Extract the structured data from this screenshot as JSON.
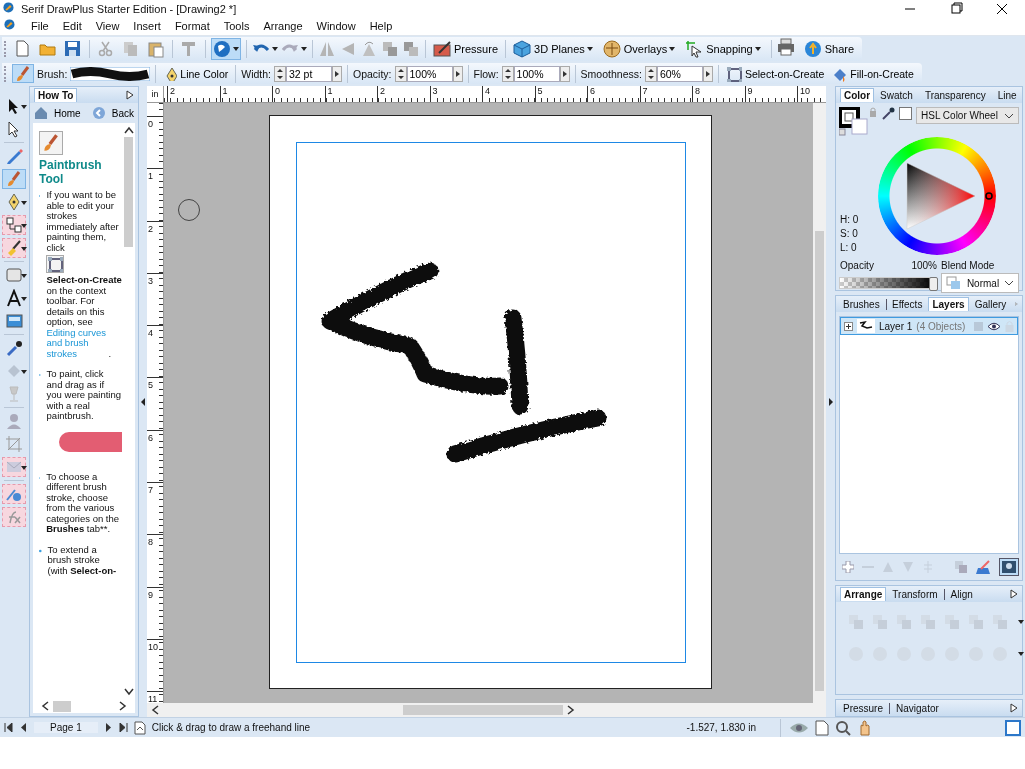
{
  "window": {
    "title": "Serif DrawPlus Starter Edition - [Drawing2 *]"
  },
  "menu": [
    "File",
    "Edit",
    "View",
    "Insert",
    "Format",
    "Tools",
    "Arrange",
    "Window",
    "Help"
  ],
  "quick_tools": [
    {
      "selected": false
    },
    {
      "selected": false
    },
    {
      "selected": false
    },
    {
      "selected": false
    },
    {
      "selected": false
    },
    {
      "selected": false
    },
    {
      "selected": false
    },
    {
      "selected": true
    }
  ],
  "toolbar_buttons": [
    {
      "label": "Pressure",
      "dropdown": false
    },
    {
      "label": "3D Planes",
      "dropdown": true
    },
    {
      "label": "Overlays",
      "dropdown": true
    },
    {
      "label": "Snapping",
      "dropdown": true
    },
    {
      "label": "Share",
      "dropdown": false
    }
  ],
  "context_bar": {
    "brush_label": "Brush:",
    "line_color": "Line Color",
    "fields": [
      {
        "label": "Width:",
        "value": "32 pt"
      },
      {
        "label": "Opacity:",
        "value": "100%"
      },
      {
        "label": "Flow:",
        "value": "100%"
      },
      {
        "label": "Smoothness:",
        "value": "60%"
      }
    ],
    "toggles": [
      {
        "label": "Select-on-Create"
      },
      {
        "label": "Fill-on-Create"
      }
    ]
  },
  "tools": [
    {
      "selected": false
    },
    {
      "selected": false
    },
    {
      "selected": false
    },
    {
      "selected": true
    },
    {
      "selected": false
    },
    {
      "selected": false
    },
    {
      "selected": false
    },
    {
      "selected": false
    },
    {
      "selected": false
    },
    {
      "selected": false
    },
    {
      "selected": false
    },
    {
      "selected": false
    },
    {
      "selected": false
    },
    {
      "selected": false
    },
    {
      "selected": false
    },
    {
      "selected": false
    },
    {
      "selected": false
    },
    {
      "selected": false
    }
  ],
  "howto": {
    "tab": "How To",
    "home": "Home",
    "back": "Back",
    "heading": "Paintbrush Tool",
    "bullets": [
      {
        "text": "If you want to be able to edit your strokes immediately after painting them, click",
        "after_icon": "**Select-on-Create** on the context toolbar. For details on this option, see",
        "link": "Editing curves and brush strokes",
        "end": "."
      },
      {
        "text": "To paint, click and drag as if you were painting with a real paintbrush."
      },
      {
        "text": "To choose a different brush stroke, choose from the various categories on the **Brushes** tab**."
      },
      {
        "text": "To extend a brush stroke (with **Select-on-**"
      }
    ]
  },
  "ruler": {
    "unit": "in",
    "x_labels": [
      "2",
      "1",
      "0",
      "1",
      "2",
      "3",
      "4",
      "5",
      "6",
      "7",
      "8",
      "9",
      "10"
    ],
    "y_labels": [
      "0",
      "1",
      "2",
      "3",
      "4",
      "5",
      "6",
      "7",
      "8",
      "9",
      "10",
      "11"
    ]
  },
  "color_panel": {
    "tabs": [
      {
        "label": "Color",
        "selected": true
      },
      {
        "label": "Swatch",
        "selected": false
      },
      {
        "label": "Transparency",
        "selected": false
      },
      {
        "label": "Line",
        "selected": false
      }
    ],
    "mode": "HSL Color Wheel",
    "h": "H: 0",
    "s": "S: 0",
    "l": "L: 0",
    "opacity_label": "Opacity",
    "opacity_value": "100%",
    "opacity": {
      "level": 1
    },
    "blend_label": "Blend Mode",
    "blend": "Normal"
  },
  "layers_panel": {
    "tabs": [
      {
        "label": "Brushes",
        "selected": false
      },
      {
        "label": "Effects",
        "selected": false
      },
      {
        "label": "Layers",
        "selected": true
      },
      {
        "label": "Gallery",
        "selected": false
      }
    ],
    "layers": [
      {
        "name": "Layer 1",
        "count": "(4 Objects)",
        "selected": true,
        "expanded": false
      }
    ]
  },
  "arrange_panel": {
    "tabs": [
      {
        "label": "Arrange",
        "selected": true
      },
      {
        "label": "Transform",
        "selected": false
      },
      {
        "label": "Align",
        "selected": false
      }
    ]
  },
  "bottom_panel": {
    "tabs": [
      {
        "label": "Pressure",
        "selected": false
      },
      {
        "label": "Navigator",
        "selected": false
      }
    ]
  },
  "status_bar": {
    "page": "Page 1",
    "hint": "Click & drag to draw a freehand line",
    "coords": "-1.527,  1.830 in"
  }
}
